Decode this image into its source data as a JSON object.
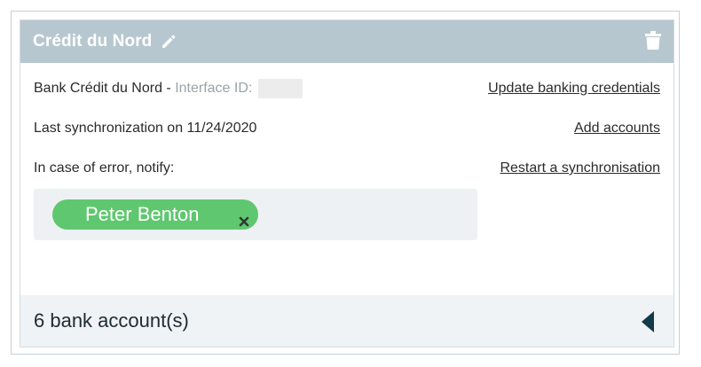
{
  "card": {
    "title": "Crédit du Nord",
    "icons": {
      "edit": "pencil-icon",
      "delete": "trash-icon",
      "toggle": "caret-left-icon",
      "remove_chip": "close-icon"
    },
    "colors": {
      "header": "#b7c7cf",
      "chip": "#5fc76f",
      "footer": "#f0f3f5"
    }
  },
  "info": {
    "bank_label": "Bank Crédit du Nord -",
    "interface_label": "Interface ID:",
    "interface_value": "",
    "last_sync": "Last synchronization on 11/24/2020",
    "notify_label": "In case of error, notify:"
  },
  "actions": {
    "update_credentials": "Update banking credentials",
    "add_accounts": "Add accounts",
    "restart_sync": "Restart a synchronisation"
  },
  "notify": {
    "recipients": [
      "Peter Benton"
    ]
  },
  "footer": {
    "accounts_count": "6 bank account(s)"
  }
}
